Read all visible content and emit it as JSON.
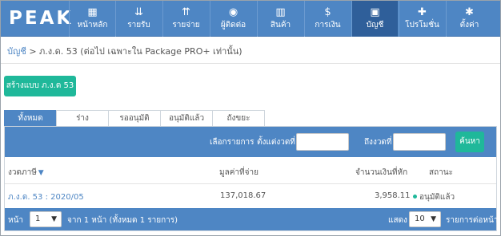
{
  "app": {
    "logo": "PEAK"
  },
  "nav": {
    "items": [
      {
        "label": "หน้าหลัก",
        "icon": "grid-icon",
        "glyph": "▦"
      },
      {
        "label": "รายรับ",
        "icon": "income-icon",
        "glyph": "⇊"
      },
      {
        "label": "รายจ่าย",
        "icon": "expense-icon",
        "glyph": "⇈"
      },
      {
        "label": "ผู้ติดต่อ",
        "icon": "contact-icon",
        "glyph": "◉"
      },
      {
        "label": "สินค้า",
        "icon": "product-icon",
        "glyph": "▥"
      },
      {
        "label": "การเงิน",
        "icon": "money-icon",
        "glyph": "$"
      },
      {
        "label": "บัญชี",
        "icon": "briefcase-icon",
        "glyph": "▣"
      },
      {
        "label": "โปรโมชั่น",
        "icon": "gift-icon",
        "glyph": "✚"
      },
      {
        "label": "ตั้งค่า",
        "icon": "gear-icon",
        "glyph": "✱"
      }
    ],
    "active_index": 6
  },
  "breadcrumb": {
    "root": "บัญชี",
    "separator": " > ",
    "current": "ภ.ง.ด. 53 (ต่อไป เฉพาะใน Package PRO+ เท่านั้น)"
  },
  "create_button": "สร้างแบบ ภ.ง.ด 53",
  "tabs": [
    "ทั้งหมด",
    "ร่าง",
    "รออนุมัติ",
    "อนุมัติแล้ว",
    "ถังขยะ"
  ],
  "filter": {
    "select_label": "เลือกรายการ",
    "from_label": "ตั้งแต่งวดที่",
    "to_label": "ถึงงวดที่",
    "from_value": "",
    "to_value": "",
    "search_button": "ค้นหา"
  },
  "table": {
    "headers": {
      "period": "งวดภาษี",
      "amount": "มูลค่าที่จ่าย",
      "withheld": "จำนวนเงินที่หัก",
      "status": "สถานะ"
    },
    "rows": [
      {
        "period": "ภ.ง.ด. 53 : 2020/05",
        "amount": "137,018.67",
        "withheld": "3,958.11",
        "status": "อนุมัติแล้ว"
      }
    ]
  },
  "pagination": {
    "page_label": "หน้า",
    "page_value": "1",
    "summary": "จาก 1 หน้า (ทั้งหมด 1 รายการ)",
    "show_label": "แสดง",
    "per_page_value": "10",
    "per_page_label": "รายการต่อหน้า"
  },
  "colors": {
    "primary": "#4e86c4",
    "nav_active": "#2f5f9a",
    "accent": "#1fb89a"
  }
}
